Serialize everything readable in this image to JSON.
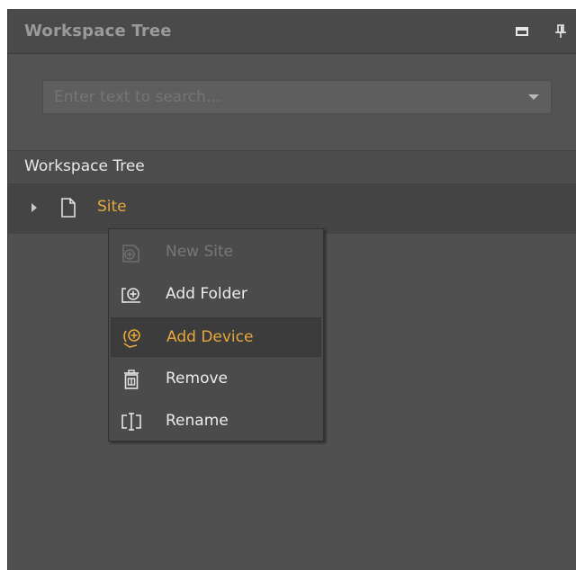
{
  "panel": {
    "title": "Workspace Tree",
    "maximize_icon": "maximize-icon",
    "pin_icon": "pin-icon"
  },
  "search": {
    "placeholder": "Enter text to search...",
    "value": ""
  },
  "section": {
    "label": "Workspace Tree"
  },
  "tree": {
    "items": [
      {
        "label": "Site",
        "icon": "site-page-icon",
        "expanded": false,
        "selected": true
      }
    ]
  },
  "context_menu": {
    "items": [
      {
        "label": "New Site",
        "icon": "new-site-icon",
        "enabled": false,
        "highlighted": false
      },
      {
        "label": "Add Folder",
        "icon": "add-folder-icon",
        "enabled": true,
        "highlighted": false
      },
      {
        "label": "Add Device",
        "icon": "add-device-icon",
        "enabled": true,
        "highlighted": true
      },
      {
        "label": "Remove",
        "icon": "remove-icon",
        "enabled": true,
        "highlighted": false
      },
      {
        "label": "Rename",
        "icon": "rename-icon",
        "enabled": true,
        "highlighted": false
      }
    ]
  },
  "colors": {
    "panel_bg": "#505050",
    "accent": "#e8a93a",
    "text": "#ececec",
    "disabled_text": "#777777"
  }
}
